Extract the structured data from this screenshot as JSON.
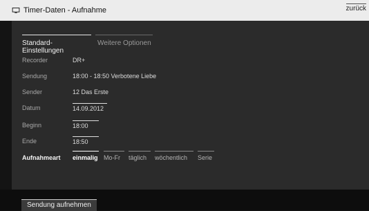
{
  "header": {
    "title": "Timer-Daten - Aufnahme",
    "back_label": "zurück",
    "icon": "tv-icon"
  },
  "tabs": [
    {
      "label": "Standard-Einstellungen",
      "active": true
    },
    {
      "label": "Weitere Optionen",
      "active": false
    }
  ],
  "fields": {
    "recorder": {
      "label": "Recorder",
      "value": "DR+"
    },
    "sendung": {
      "label": "Sendung",
      "value": "18:00 - 18:50 Verbotene Liebe"
    },
    "sender": {
      "label": "Sender",
      "value": "12 Das Erste"
    },
    "datum": {
      "label": "Datum",
      "value": "14.09.2012"
    },
    "beginn": {
      "label": "Beginn",
      "value": "18:00"
    },
    "ende": {
      "label": "Ende",
      "value": "18:50"
    }
  },
  "aufnahmeart": {
    "label": "Aufnahmeart",
    "options": [
      "einmalig",
      "Mo-Fr",
      "täglich",
      "wöchentlich",
      "Serie"
    ],
    "selected": "einmalig"
  },
  "footer": {
    "record_button_label": "Sendung aufnehmen"
  }
}
